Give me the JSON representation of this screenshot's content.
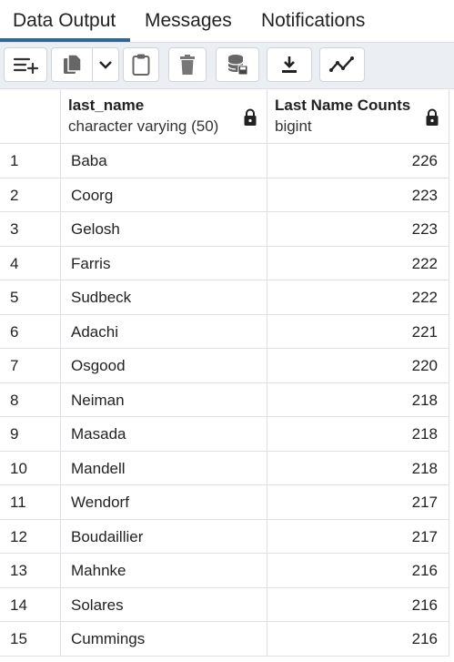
{
  "tabs": [
    "Data Output",
    "Messages",
    "Notifications"
  ],
  "toolbar": {
    "icons": [
      "add-row-icon",
      "copy-icon",
      "chevron-down-icon",
      "paste-icon",
      "delete-icon",
      "save-data-icon",
      "download-icon",
      "graph-icon"
    ]
  },
  "columns": [
    {
      "name": "last_name",
      "type": "character varying (50)"
    },
    {
      "name": "Last Name Counts",
      "type": "bigint"
    }
  ],
  "rows": [
    {
      "n": "1",
      "last_name": "Baba",
      "count": "226"
    },
    {
      "n": "2",
      "last_name": "Coorg",
      "count": "223"
    },
    {
      "n": "3",
      "last_name": "Gelosh",
      "count": "223"
    },
    {
      "n": "4",
      "last_name": "Farris",
      "count": "222"
    },
    {
      "n": "5",
      "last_name": "Sudbeck",
      "count": "222"
    },
    {
      "n": "6",
      "last_name": "Adachi",
      "count": "221"
    },
    {
      "n": "7",
      "last_name": "Osgood",
      "count": "220"
    },
    {
      "n": "8",
      "last_name": "Neiman",
      "count": "218"
    },
    {
      "n": "9",
      "last_name": "Masada",
      "count": "218"
    },
    {
      "n": "10",
      "last_name": "Mandell",
      "count": "218"
    },
    {
      "n": "11",
      "last_name": "Wendorf",
      "count": "217"
    },
    {
      "n": "12",
      "last_name": "Boudaillier",
      "count": "217"
    },
    {
      "n": "13",
      "last_name": "Mahnke",
      "count": "216"
    },
    {
      "n": "14",
      "last_name": "Solares",
      "count": "216"
    },
    {
      "n": "15",
      "last_name": "Cummings",
      "count": "216"
    }
  ]
}
